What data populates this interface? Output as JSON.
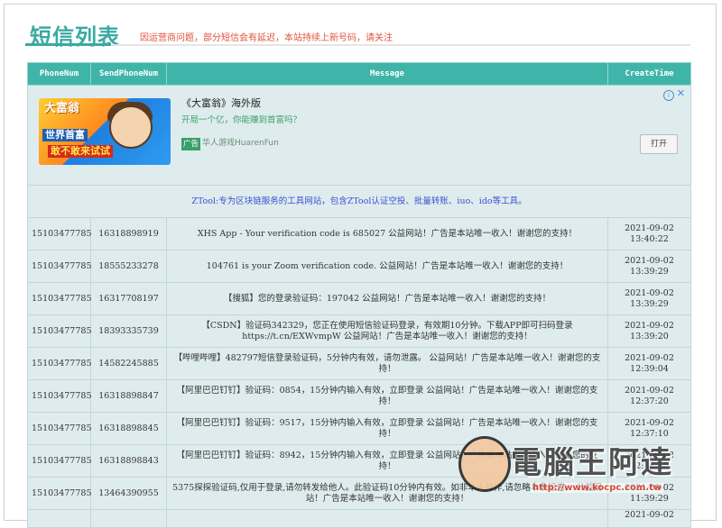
{
  "header": {
    "title": "短信列表",
    "notice": "因运营商问题，部分短信会有延迟，本站持续上新号码，请关注"
  },
  "table": {
    "columns": [
      "PhoneNum",
      "SendPhoneNum",
      "Message",
      "CreateTime"
    ],
    "ad": {
      "image_lines": [
        "大富翁",
        "世界首富",
        "敢不敢来试试"
      ],
      "title": "《大富翁》海外版",
      "description": "开局一个亿，你能赚到首富吗？",
      "tag": "广告",
      "source": "华人游戏HuarenFun",
      "open_button": "打开",
      "info_icon": "info-icon",
      "close_icon": "close-icon"
    },
    "promo_text": "ZTool:专为区块链服务的工具网站，包含ZTool认证空投、批量转账、iuo、ido等工具。",
    "rows": [
      {
        "phone": "15103477785",
        "sender": "16318898919",
        "message": "XHS App - Your verification code is 685027 公益网站！广告是本站唯一收入！谢谢您的支持！",
        "date": "2021-09-02",
        "time": "13:40:22"
      },
      {
        "phone": "15103477785",
        "sender": "18555233278",
        "message": "104761 is your Zoom verification code. 公益网站！广告是本站唯一收入！谢谢您的支持！",
        "date": "2021-09-02",
        "time": "13:39:29"
      },
      {
        "phone": "15103477785",
        "sender": "16317708197",
        "message": "【搜狐】您的登录验证码：197042 公益网站！广告是本站唯一收入！谢谢您的支持！",
        "date": "2021-09-02",
        "time": "13:39:29"
      },
      {
        "phone": "15103477785",
        "sender": "18393335739",
        "message": "【CSDN】验证码342329，您正在使用短信验证码登录，有效期10分钟。下载APP即可扫码登录 https://t.cn/EXWvmpW 公益网站！广告是本站唯一收入！谢谢您的支持！",
        "date": "2021-09-02",
        "time": "13:39:20"
      },
      {
        "phone": "15103477785",
        "sender": "14582245885",
        "message": "【哔哩哔哩】482797短信登录验证码，5分钟内有效，请勿泄露。 公益网站！广告是本站唯一收入！谢谢您的支持！",
        "date": "2021-09-02",
        "time": "12:39:04"
      },
      {
        "phone": "15103477785",
        "sender": "16318898847",
        "message": "【阿里巴巴钉钉】验证码：0854，15分钟内输入有效，立即登录 公益网站！广告是本站唯一收入！谢谢您的支持！",
        "date": "2021-09-02",
        "time": "12:37:20"
      },
      {
        "phone": "15103477785",
        "sender": "16318898845",
        "message": "【阿里巴巴钉钉】验证码：9517，15分钟内输入有效，立即登录 公益网站！广告是本站唯一收入！谢谢您的支持！",
        "date": "2021-09-02",
        "time": "12:37:10"
      },
      {
        "phone": "15103477785",
        "sender": "16318898843",
        "message": "【阿里巴巴钉钉】验证码：8942，15分钟内输入有效，立即登录 公益网站！广告是本站唯一收入！谢谢您的支持！",
        "date": "2021-09-02",
        "time": "12:36:53"
      },
      {
        "phone": "15103477785",
        "sender": "13464390955",
        "message": "5375探探验证码,仅用于登录,请勿转发给他人。此验证码10分钟内有效。如非本人操作,请忽略本条短信。 公益网站！广告是本站唯一收入！谢谢您的支持！",
        "date": "2021-09-02",
        "time": "11:39:29"
      }
    ],
    "partial_row_date": "2021-09-02"
  },
  "watermark": {
    "text": "電腦王阿達",
    "url": "http://www.kocpc.com.tw"
  }
}
